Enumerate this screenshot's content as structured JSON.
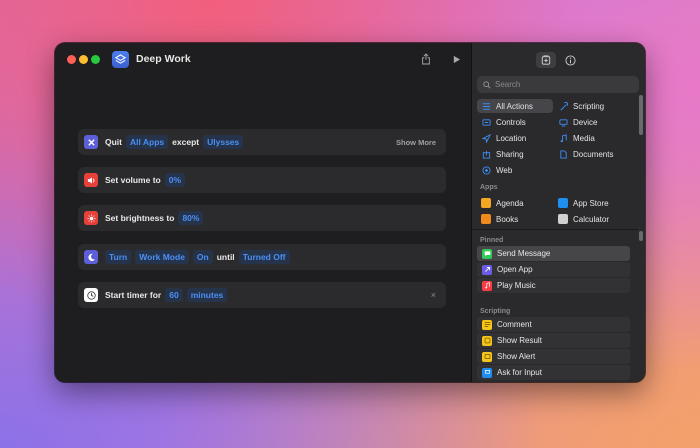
{
  "window": {
    "title": "Deep Work"
  },
  "actions": [
    {
      "id": "quit",
      "parts": [
        {
          "kind": "text",
          "value": "Quit"
        },
        {
          "kind": "token",
          "value": "All Apps"
        },
        {
          "kind": "text",
          "value": "except"
        },
        {
          "kind": "token",
          "value": "Ulysses"
        }
      ],
      "show_more": "Show More",
      "icon": "quit-app-icon",
      "color": "#5d5fd8"
    },
    {
      "id": "volume",
      "parts": [
        {
          "kind": "text",
          "value": "Set volume to"
        },
        {
          "kind": "token",
          "value": "0%"
        }
      ],
      "icon": "speaker-icon",
      "color": "#e5413a"
    },
    {
      "id": "brightness",
      "parts": [
        {
          "kind": "text",
          "value": "Set brightness to"
        },
        {
          "kind": "token",
          "value": "80%"
        }
      ],
      "icon": "sun-icon",
      "color": "#e5413a"
    },
    {
      "id": "focus",
      "parts": [
        {
          "kind": "token",
          "value": "Turn"
        },
        {
          "kind": "token",
          "value": "Work Mode"
        },
        {
          "kind": "token",
          "value": "On"
        },
        {
          "kind": "text",
          "value": "until"
        },
        {
          "kind": "token",
          "value": "Turned Off"
        }
      ],
      "icon": "moon-icon",
      "color": "#5d5fd8"
    },
    {
      "id": "timer",
      "parts": [
        {
          "kind": "text",
          "value": "Start timer for"
        },
        {
          "kind": "token",
          "value": "60"
        },
        {
          "kind": "token",
          "value": "minutes"
        }
      ],
      "close": "×",
      "icon": "clock-icon",
      "color": "#ffffff"
    }
  ],
  "sidebar": {
    "search_placeholder": "Search",
    "categories": [
      {
        "label": "All Actions",
        "icon": "list-icon",
        "selected": true
      },
      {
        "label": "Scripting",
        "icon": "scripting-icon"
      },
      {
        "label": "Controls",
        "icon": "controls-icon"
      },
      {
        "label": "Device",
        "icon": "device-icon"
      },
      {
        "label": "Location",
        "icon": "location-icon"
      },
      {
        "label": "Media",
        "icon": "music-note-icon"
      },
      {
        "label": "Sharing",
        "icon": "sharing-icon"
      },
      {
        "label": "Documents",
        "icon": "document-icon"
      },
      {
        "label": "Web",
        "icon": "web-icon"
      }
    ],
    "apps_header": "Apps",
    "apps": [
      {
        "label": "Agenda",
        "icon": "agenda-icon",
        "color": "#f5a623"
      },
      {
        "label": "App Store",
        "icon": "app-store-icon",
        "color": "#1f8ef1"
      },
      {
        "label": "Books",
        "icon": "books-icon",
        "color": "#f08a1c"
      },
      {
        "label": "Calculator",
        "icon": "calculator-icon",
        "color": "#d0d0d0"
      }
    ],
    "pinned_header": "Pinned",
    "pinned": [
      {
        "label": "Send Message",
        "icon": "message-icon",
        "color": "#34c759"
      },
      {
        "label": "Open App",
        "icon": "open-app-icon",
        "color": "#6b5ce7"
      },
      {
        "label": "Play Music",
        "icon": "music-icon",
        "color": "#fc3c44"
      }
    ],
    "scripting_header": "Scripting",
    "scripting": [
      {
        "label": "Comment",
        "icon": "comment-icon",
        "color": "#f5c518"
      },
      {
        "label": "Show Result",
        "icon": "show-result-icon",
        "color": "#f5c518"
      },
      {
        "label": "Show Alert",
        "icon": "show-alert-icon",
        "color": "#f5c518"
      },
      {
        "label": "Ask for Input",
        "icon": "ask-input-icon",
        "color": "#1f8ef1"
      }
    ]
  }
}
